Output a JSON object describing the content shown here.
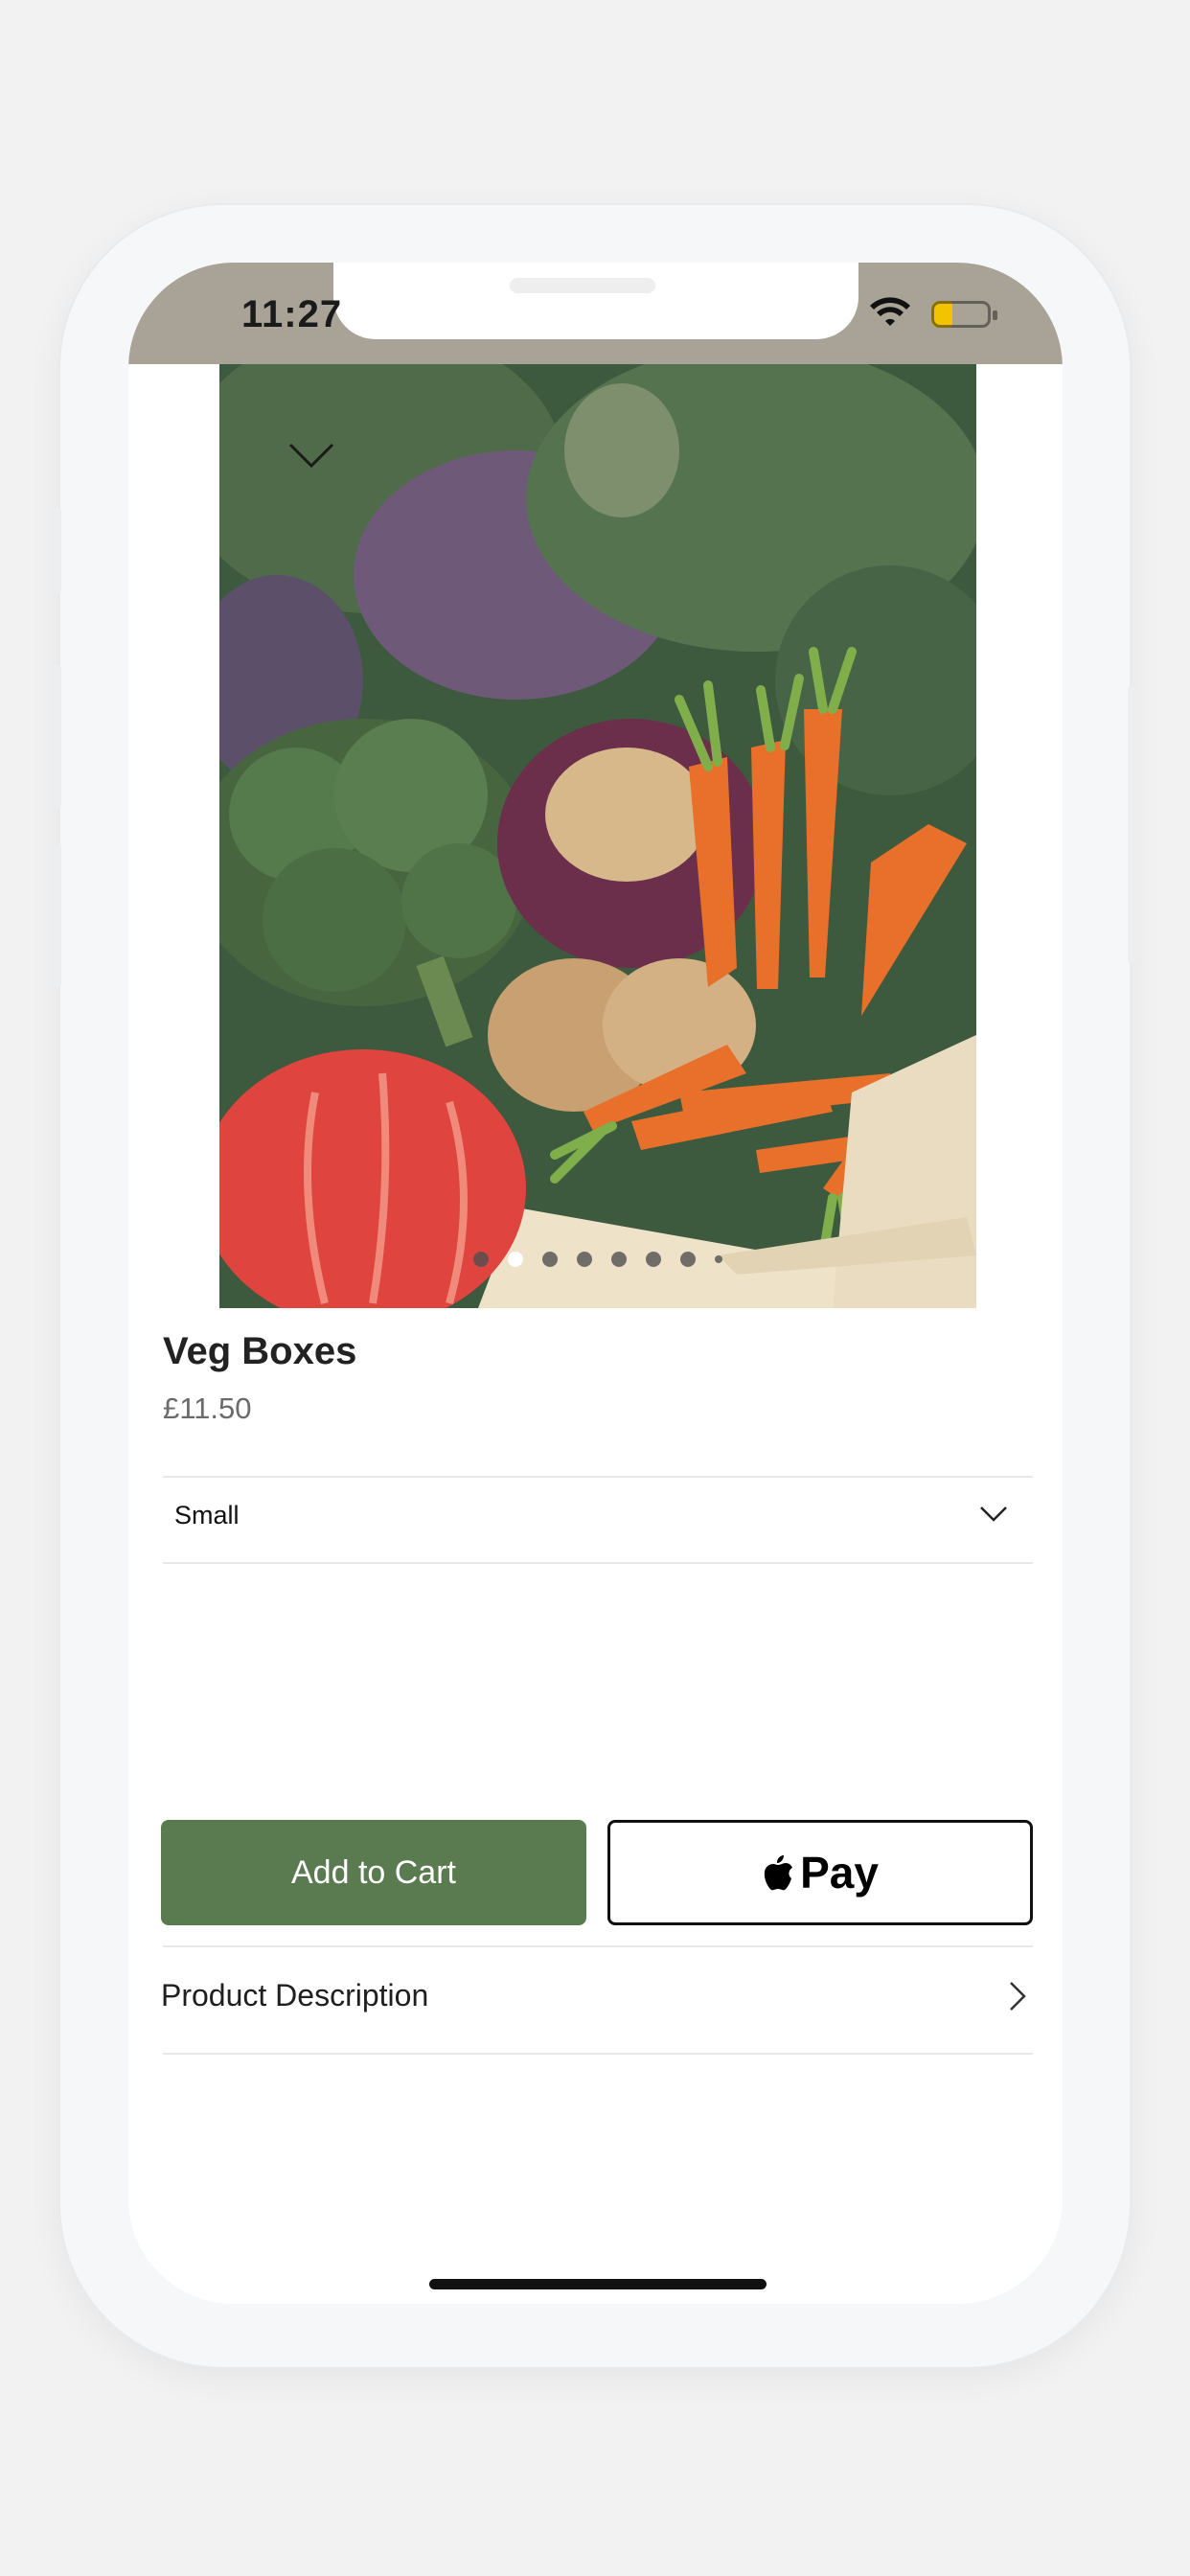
{
  "status_bar": {
    "time": "11:27",
    "wifi_icon": "wifi-icon",
    "battery_icon": "battery-icon",
    "battery_level": 0.3
  },
  "product": {
    "image_alt": "Box of mixed vegetables: kale, broccoli, celeriac, carrots, squash, potatoes and parsnips",
    "gallery_count": 8,
    "gallery_active_index": 1,
    "title": "Veg Boxes",
    "price": "£11.50",
    "size": "Small"
  },
  "actions": {
    "add_to_cart": "Add to Cart",
    "apple_pay": "Pay"
  },
  "sections": {
    "product_description": "Product Description"
  },
  "colors": {
    "primary_button": "#5a7b50",
    "status_bar_bg": "#a8a396"
  }
}
